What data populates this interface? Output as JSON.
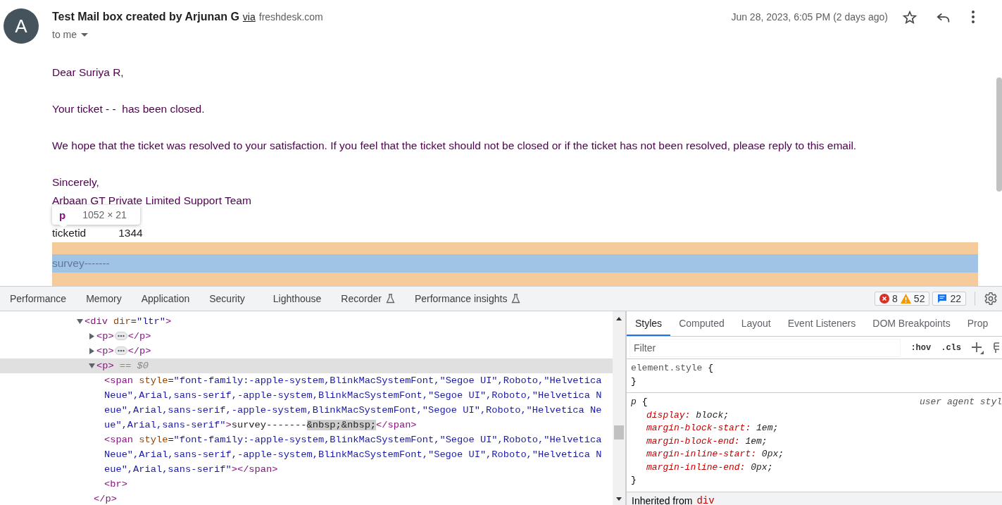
{
  "email": {
    "avatar_initial": "A",
    "subject": "Test Mail box created by Arjunan G",
    "via": "via",
    "via_domain": "freshdesk.com",
    "recipient": "to me",
    "date": "Jun 28, 2023, 6:05 PM (2 days ago)",
    "paragraphs": [
      [
        "Dear Suriya R,"
      ],
      [
        "Your ticket - -  has been closed."
      ],
      [
        "We hope that the ticket was resolved to your satisfaction. If you feel that the ticket should not be closed or if the ticket has not been resolved, please reply to this email."
      ],
      [
        "Sincerely,",
        "Arbaan GT Private Limited Support Team"
      ]
    ],
    "ticket_label": "ticketid",
    "ticket_value": "1344",
    "survey": "survey-------"
  },
  "inspect_tooltip": {
    "tag": "p",
    "size": "1052 × 21"
  },
  "devtools": {
    "tabs": [
      {
        "label": "Performance",
        "selected": false,
        "experimental": false
      },
      {
        "label": "Memory",
        "selected": false,
        "experimental": false
      },
      {
        "label": "Application",
        "selected": false,
        "experimental": false
      },
      {
        "label": "Security",
        "selected": false,
        "experimental": false
      },
      {
        "label": "Lighthouse",
        "selected": false,
        "experimental": false
      },
      {
        "label": "Recorder",
        "selected": false,
        "experimental": true
      },
      {
        "label": "Performance insights",
        "selected": false,
        "experimental": true
      }
    ],
    "errors": "8",
    "warnings": "52",
    "messages": "22",
    "dom": [
      {
        "expanded": true,
        "selected": false,
        "segments": [
          {
            "kind": "tag",
            "text": "<div"
          },
          {
            "kind": "attr",
            "text": " dir"
          },
          {
            "kind": "text",
            "text": "="
          },
          {
            "kind": "value",
            "text": "\"ltr\""
          },
          {
            "kind": "tag",
            "text": ">"
          }
        ],
        "children": [
          {
            "expanded": false,
            "selected": false,
            "segments": [
              {
                "kind": "tag",
                "text": "<p>"
              },
              {
                "kind": "ellipsis"
              },
              {
                "kind": "tag",
                "text": "</p>"
              }
            ]
          },
          {
            "expanded": false,
            "selected": false,
            "segments": [
              {
                "kind": "tag",
                "text": "<p>"
              },
              {
                "kind": "ellipsis"
              },
              {
                "kind": "tag",
                "text": "</p>"
              }
            ]
          },
          {
            "expanded": true,
            "selected": true,
            "segments": [
              {
                "kind": "tag",
                "text": "<p>"
              },
              {
                "kind": "hint",
                "text": " == $0"
              }
            ],
            "children": [
              {
                "segments": [
                  {
                    "kind": "tag",
                    "text": "<span"
                  },
                  {
                    "kind": "attr",
                    "text": " style"
                  },
                  {
                    "kind": "text",
                    "text": "="
                  },
                  {
                    "kind": "value",
                    "text": "\"font-family:-apple-system,BlinkMacSystemFont,\"Segoe UI\",Roboto,\"Helvetica Neue\",Arial,sans-serif,-apple-system,BlinkMacSystemFont,\"Segoe UI\",Roboto,\"Helvetica Neue\",Arial,sans-serif,-apple-system,BlinkMacSystemFont,\"Segoe UI\",Roboto,\"Helvetica Neue\",Arial,sans-serif\""
                  },
                  {
                    "kind": "tag",
                    "text": ">"
                  },
                  {
                    "kind": "text",
                    "text": "survey-------"
                  },
                  {
                    "kind": "highlight",
                    "text": "&nbsp;&nbsp;"
                  },
                  {
                    "kind": "tag",
                    "text": "</span>"
                  }
                ]
              },
              {
                "segments": [
                  {
                    "kind": "tag",
                    "text": "<span"
                  },
                  {
                    "kind": "attr",
                    "text": " style"
                  },
                  {
                    "kind": "text",
                    "text": "="
                  },
                  {
                    "kind": "value",
                    "text": "\"font-family:-apple-system,BlinkMacSystemFont,\"Segoe UI\",Roboto,\"Helvetica Neue\",Arial,sans-serif,-apple-system,BlinkMacSystemFont,\"Segoe UI\",Roboto,\"Helvetica Neue\",Arial,sans-serif\""
                  },
                  {
                    "kind": "tag",
                    "text": "></span>"
                  }
                ]
              },
              {
                "segments": [
                  {
                    "kind": "tag",
                    "text": "<br>"
                  }
                ]
              }
            ],
            "closing": [
              {
                "kind": "tag",
                "text": "</p>"
              }
            ]
          }
        ]
      }
    ],
    "style_tabs": [
      {
        "label": "Styles",
        "selected": true
      },
      {
        "label": "Computed",
        "selected": false
      },
      {
        "label": "Layout",
        "selected": false
      },
      {
        "label": "Event Listeners",
        "selected": false
      },
      {
        "label": "DOM Breakpoints",
        "selected": false
      },
      {
        "label": "Prop",
        "selected": false
      }
    ],
    "filter": {
      "placeholder": "Filter"
    },
    "hov": ":hov",
    "cls": ".cls",
    "rules": [
      {
        "selector": "element.style",
        "open": "{",
        "close": "}"
      },
      {
        "selector": "p",
        "open": "{",
        "close": "}",
        "origin": "user agent styl",
        "declarations": [
          {
            "name": "display:",
            "value": "block;"
          },
          {
            "name": "margin-block-start:",
            "value": "1em;"
          },
          {
            "name": "margin-block-end:",
            "value": "1em;"
          },
          {
            "name": "margin-inline-start:",
            "value": "0px;"
          },
          {
            "name": "margin-inline-end:",
            "value": "0px;"
          }
        ]
      }
    ],
    "inherited_label": "Inherited from",
    "inherited_tag": "div"
  }
}
